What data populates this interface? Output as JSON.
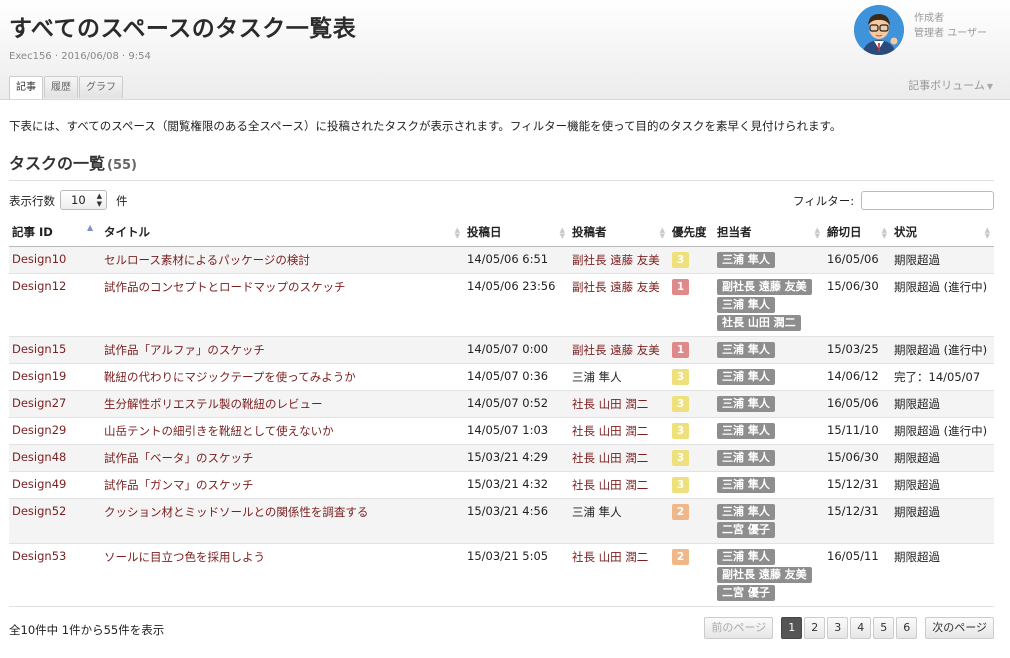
{
  "header": {
    "title": "すべてのスペースのタスク一覧表",
    "meta": "Exec156 · 2016/06/08 · 9:54",
    "author_label": "作成者",
    "author_name": "管理者 ユーザー",
    "tabs": [
      "記事",
      "履歴",
      "グラフ"
    ],
    "active_tab": "記事",
    "volume_label": "記事ボリューム"
  },
  "intro": "下表には、すべてのスペース（閲覧権限のある全スペース）に投稿されたタスクが表示されます。フィルター機能を使って目的のタスクを素早く見付けられます。",
  "section": {
    "title": "タスクの一覧",
    "count": "(55)"
  },
  "controls": {
    "rows_label": "表示行数",
    "rows_value": "10",
    "rows_unit": "件",
    "filter_label": "フィルター:",
    "filter_value": ""
  },
  "table": {
    "columns": [
      "記事 ID",
      "タイトル",
      "投稿日",
      "投稿者",
      "優先度",
      "担当者",
      "締切日",
      "状況"
    ],
    "rows": [
      {
        "id": "Design10",
        "title": "セルロース素材によるパッケージの検討",
        "date": "14/05/06 6:51",
        "poster": "副社長 遠藤 友美",
        "poster_link": true,
        "priority": "3",
        "assignees": [
          "三浦 隼人"
        ],
        "deadline": "16/05/06",
        "status": "期限超過"
      },
      {
        "id": "Design12",
        "title": "試作品のコンセプトとロードマップのスケッチ",
        "date": "14/05/06 23:56",
        "poster": "副社長 遠藤 友美",
        "poster_link": true,
        "priority": "1",
        "assignees": [
          "副社長 遠藤 友美",
          "三浦 隼人",
          "社長 山田 潤二"
        ],
        "deadline": "15/06/30",
        "status": "期限超過 (進行中)"
      },
      {
        "id": "Design15",
        "title": "試作品「アルファ」のスケッチ",
        "date": "14/05/07 0:00",
        "poster": "副社長 遠藤 友美",
        "poster_link": true,
        "priority": "1",
        "assignees": [
          "三浦 隼人"
        ],
        "deadline": "15/03/25",
        "status": "期限超過 (進行中)"
      },
      {
        "id": "Design19",
        "title": "靴紐の代わりにマジックテープを使ってみようか",
        "date": "14/05/07 0:36",
        "poster": "三浦 隼人",
        "poster_link": false,
        "priority": "3",
        "assignees": [
          "三浦 隼人"
        ],
        "deadline": "14/06/12",
        "status": "完了：14/05/07"
      },
      {
        "id": "Design27",
        "title": "生分解性ポリエステル製の靴紐のレビュー",
        "date": "14/05/07 0:52",
        "poster": "社長 山田 潤二",
        "poster_link": true,
        "priority": "3",
        "assignees": [
          "三浦 隼人"
        ],
        "deadline": "16/05/06",
        "status": "期限超過"
      },
      {
        "id": "Design29",
        "title": "山岳テントの細引きを靴紐として使えないか",
        "date": "14/05/07 1:03",
        "poster": "社長 山田 潤二",
        "poster_link": true,
        "priority": "3",
        "assignees": [
          "三浦 隼人"
        ],
        "deadline": "15/11/10",
        "status": "期限超過 (進行中)"
      },
      {
        "id": "Design48",
        "title": "試作品「ベータ」のスケッチ",
        "date": "15/03/21 4:29",
        "poster": "社長 山田 潤二",
        "poster_link": true,
        "priority": "3",
        "assignees": [
          "三浦 隼人"
        ],
        "deadline": "15/06/30",
        "status": "期限超過"
      },
      {
        "id": "Design49",
        "title": "試作品「ガンマ」のスケッチ",
        "date": "15/03/21 4:32",
        "poster": "社長 山田 潤二",
        "poster_link": true,
        "priority": "3",
        "assignees": [
          "三浦 隼人"
        ],
        "deadline": "15/12/31",
        "status": "期限超過"
      },
      {
        "id": "Design52",
        "title": "クッション材とミッドソールとの関係性を調査する",
        "date": "15/03/21 4:56",
        "poster": "三浦 隼人",
        "poster_link": false,
        "priority": "2",
        "assignees": [
          "三浦 隼人",
          "二宮 優子"
        ],
        "deadline": "15/12/31",
        "status": "期限超過"
      },
      {
        "id": "Design53",
        "title": "ソールに目立つ色を採用しよう",
        "date": "15/03/21 5:05",
        "poster": "社長 山田 潤二",
        "poster_link": true,
        "priority": "2",
        "assignees": [
          "三浦 隼人",
          "副社長 遠藤 友美",
          "二宮 優子"
        ],
        "deadline": "16/05/11",
        "status": "期限超過"
      }
    ]
  },
  "priority_colors": {
    "1": "#e0898a",
    "2": "#f0b888",
    "3": "#eee07a"
  },
  "footer": {
    "info": "全10件中 1件から55件を表示",
    "prev": "前のページ",
    "next": "次のページ",
    "pages": [
      "1",
      "2",
      "3",
      "4",
      "5",
      "6"
    ],
    "current_page": "1"
  }
}
